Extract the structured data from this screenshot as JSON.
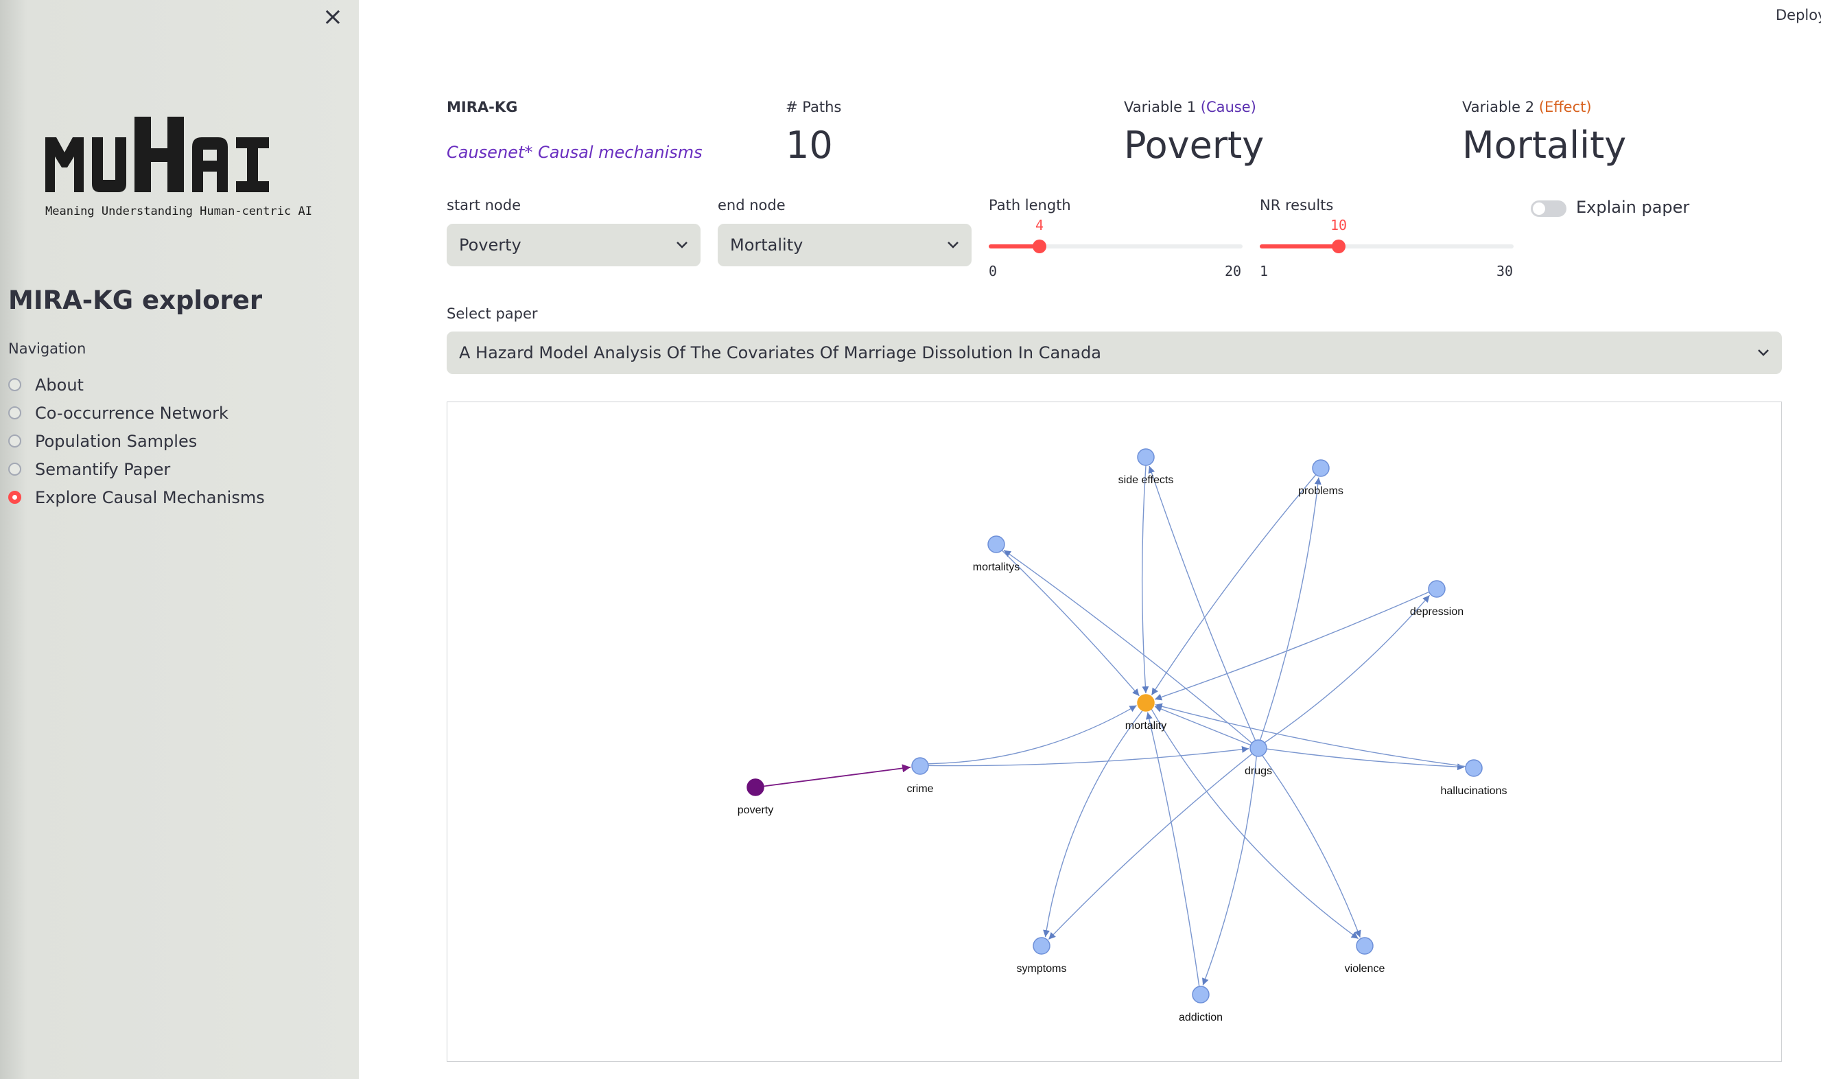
{
  "sidebar": {
    "close_icon": "close-icon",
    "logo": {
      "wordmark": "MUHAI",
      "tagline": "Meaning Understanding Human-centric AI"
    },
    "title": "MIRA-KG explorer",
    "nav_label": "Navigation",
    "nav_items": [
      {
        "label": "About",
        "selected": false
      },
      {
        "label": "Co-occurrence Network",
        "selected": false
      },
      {
        "label": "Population Samples",
        "selected": false
      },
      {
        "label": "Semantify Paper",
        "selected": false
      },
      {
        "label": "Explore Causal Mechanisms",
        "selected": true
      }
    ],
    "accent_color": "#ff4b4b"
  },
  "header": {
    "deploy_label": "Deploy"
  },
  "metrics": {
    "source_label": "MIRA-KG",
    "source_link": "Causenet* Causal mechanisms",
    "paths_icon": "hash-icon",
    "paths_label": "Paths",
    "paths_value": "10",
    "var1_label": "Variable 1",
    "var1_tag": "(Cause)",
    "var1_value": "Poverty",
    "var2_label": "Variable 2",
    "var2_tag": "(Effect)",
    "var2_value": "Mortality"
  },
  "controls": {
    "start_node_label": "start node",
    "start_node_value": "Poverty",
    "end_node_label": "end node",
    "end_node_value": "Mortality",
    "path_length": {
      "label": "Path length",
      "value": 4,
      "min": 0,
      "max": 20,
      "min_label": "0",
      "max_label": "20",
      "value_label": "4"
    },
    "nr_results": {
      "label": "NR results",
      "value": 10,
      "min": 1,
      "max": 30,
      "min_label": "1",
      "max_label": "30",
      "value_label": "10"
    },
    "explain_paper_label": "Explain paper",
    "explain_paper_on": false,
    "select_paper_label": "Select paper",
    "select_paper_value": "A Hazard Model Analysis Of The Covariates Of Marriage Dissolution In Canada"
  },
  "graph": {
    "colors": {
      "node": "#9dbcf5",
      "node_stroke": "#6e90d8",
      "edge": "#7a96cf",
      "target": "#f5a623",
      "source": "#6b0f7a",
      "source_edge": "#7b1a85"
    },
    "nodes": [
      {
        "id": "side_effects",
        "label": "side effects",
        "kind": "normal"
      },
      {
        "id": "problems",
        "label": "problems",
        "kind": "normal"
      },
      {
        "id": "mortalitys",
        "label": "mortalitys",
        "kind": "normal"
      },
      {
        "id": "depression",
        "label": "depression",
        "kind": "normal"
      },
      {
        "id": "mortality",
        "label": "mortality",
        "kind": "target"
      },
      {
        "id": "drugs",
        "label": "drugs",
        "kind": "normal"
      },
      {
        "id": "crime",
        "label": "crime",
        "kind": "normal"
      },
      {
        "id": "poverty",
        "label": "poverty",
        "kind": "source"
      },
      {
        "id": "hallucinations",
        "label": "hallucinations",
        "kind": "normal"
      },
      {
        "id": "symptoms",
        "label": "symptoms",
        "kind": "normal"
      },
      {
        "id": "violence",
        "label": "violence",
        "kind": "normal"
      },
      {
        "id": "addiction",
        "label": "addiction",
        "kind": "normal"
      }
    ],
    "edges": [
      {
        "from": "poverty",
        "to": "crime"
      },
      {
        "from": "crime",
        "to": "mortality"
      },
      {
        "from": "crime",
        "to": "drugs"
      },
      {
        "from": "side_effects",
        "to": "mortality"
      },
      {
        "from": "drugs",
        "to": "side_effects"
      },
      {
        "from": "problems",
        "to": "mortality"
      },
      {
        "from": "drugs",
        "to": "problems"
      },
      {
        "from": "mortalitys",
        "to": "mortality"
      },
      {
        "from": "drugs",
        "to": "mortalitys"
      },
      {
        "from": "depression",
        "to": "mortality"
      },
      {
        "from": "drugs",
        "to": "depression"
      },
      {
        "from": "drugs",
        "to": "mortality"
      },
      {
        "from": "drugs",
        "to": "hallucinations"
      },
      {
        "from": "hallucinations",
        "to": "mortality"
      },
      {
        "from": "mortality",
        "to": "symptoms"
      },
      {
        "from": "drugs",
        "to": "symptoms"
      },
      {
        "from": "mortality",
        "to": "violence"
      },
      {
        "from": "drugs",
        "to": "violence"
      },
      {
        "from": "addiction",
        "to": "mortality"
      },
      {
        "from": "drugs",
        "to": "addiction"
      }
    ]
  }
}
